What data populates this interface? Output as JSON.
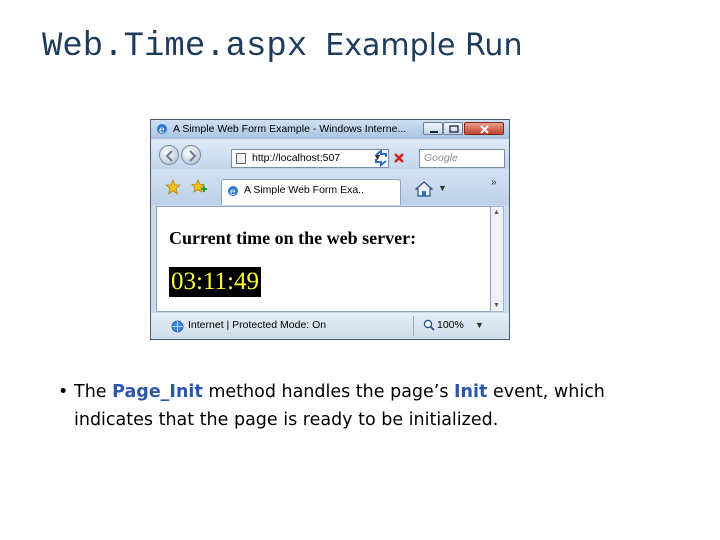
{
  "slide": {
    "title_code": "Web.Time.aspx",
    "title_rest": "Example Run",
    "bullet": {
      "dot": "•",
      "part1": "The ",
      "kw1": "Page_Init",
      "part2": " method handles the page’s ",
      "kw2": "Init",
      "part3": " event, which indicates that the page is ready to be initialized."
    }
  },
  "browser": {
    "window_title": "A Simple Web Form Example - Windows Interne...",
    "address": "http://localhost:507",
    "search_placeholder": "Google",
    "tab_label": "A Simple Web Form Exa..",
    "more_chevron": "»",
    "heading": "Current time on the web server:",
    "clock": "03:11:49",
    "status": "Internet | Protected Mode: On",
    "zoom": "100%",
    "dropdown_glyph": "▼"
  },
  "colors": {
    "keyword": "#2c57a8",
    "title": "#1f3b5c",
    "clock_bg": "#000000",
    "clock_fg": "#ffff33"
  }
}
